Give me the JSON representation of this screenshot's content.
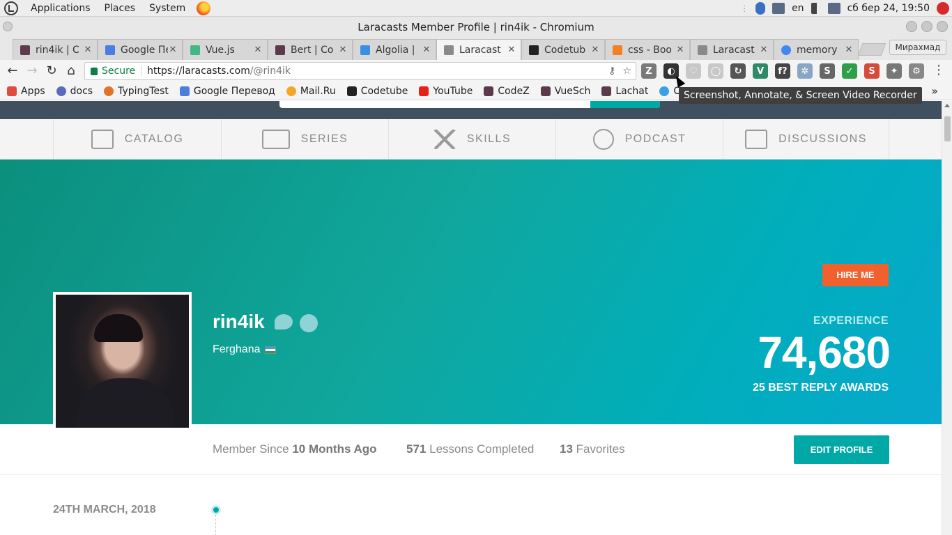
{
  "os_panel": {
    "menu": [
      "Applications",
      "Places",
      "System"
    ],
    "keyboard_layout": "en",
    "clock": "сб бер 24, 19:50"
  },
  "window": {
    "title": "Laracasts Member Profile | rin4ik - Chromium"
  },
  "tabs": [
    {
      "title": "rin4ik | C",
      "favicon_color": "#5c3a4c"
    },
    {
      "title": "Google Пер",
      "favicon_color": "#4a7ee0"
    },
    {
      "title": "Vue.js",
      "favicon_color": "#41b883"
    },
    {
      "title": "Bert | Co",
      "favicon_color": "#5c3a4c"
    },
    {
      "title": "Algolia | ",
      "favicon_color": "#3a8fe5"
    },
    {
      "title": "Laracast",
      "favicon_color": "#8a8a8a"
    },
    {
      "title": "Codetub",
      "favicon_color": "#222222"
    },
    {
      "title": "css - Boo",
      "favicon_color": "#f48024"
    },
    {
      "title": "Laracast",
      "favicon_color": "#8a8a8a"
    },
    {
      "title": "memory",
      "favicon_color": "#4285f4"
    }
  ],
  "profile_button": "Мирахмад",
  "toolbar": {
    "secure_label": "Secure",
    "url_host": "https://laracasts.com",
    "url_path": "/@rin4ik",
    "extensions": [
      "Z",
      "◐",
      "♡",
      "◯",
      "↻",
      "V",
      "f?",
      "✲",
      "S",
      "✓",
      "S",
      "✦",
      "⚙"
    ]
  },
  "bookmarks": [
    {
      "label": "Apps",
      "color": "#e04a3f"
    },
    {
      "label": "docs",
      "color": "#5a6abf"
    },
    {
      "label": "TypingTest",
      "color": "#e0742a"
    },
    {
      "label": "Google Перевод",
      "color": "#4a7ee0"
    },
    {
      "label": "Mail.Ru",
      "color": "#f5a623"
    },
    {
      "label": "Codetube",
      "color": "#222222"
    },
    {
      "label": "YouTube",
      "color": "#e62117"
    },
    {
      "label": "CodeZ",
      "color": "#5c3a4c"
    },
    {
      "label": "VueSch",
      "color": "#5c3a4c"
    },
    {
      "label": "Lachat",
      "color": "#5c3a4c"
    },
    {
      "label": "C",
      "color": "#3aa0e6"
    }
  ],
  "tooltip": "Screenshot, Annotate, & Screen Video Recorder",
  "site_nav": [
    {
      "label": "CATALOG",
      "icon": "list-icon"
    },
    {
      "label": "SERIES",
      "icon": "series-icon"
    },
    {
      "label": "SKILLS",
      "icon": "skills-icon"
    },
    {
      "label": "PODCAST",
      "icon": "podcast-icon"
    },
    {
      "label": "DISCUSSIONS",
      "icon": "discussions-icon"
    }
  ],
  "profile": {
    "username": "rin4ik",
    "location": "Ferghana",
    "hire_label": "HIRE ME",
    "experience_label": "EXPERIENCE",
    "experience_value": "74,680",
    "awards": "25 BEST REPLY AWARDS"
  },
  "stats": {
    "member_since_prefix": "Member Since",
    "member_since_value": "10 Months Ago",
    "lessons_value": "571",
    "lessons_label": "Lessons Completed",
    "favorites_value": "13",
    "favorites_label": "Favorites",
    "edit_label": "EDIT PROFILE"
  },
  "timeline": {
    "date": "24TH MARCH, 2018"
  },
  "colors": {
    "accent": "#00a9a6",
    "hire": "#f0612e"
  }
}
